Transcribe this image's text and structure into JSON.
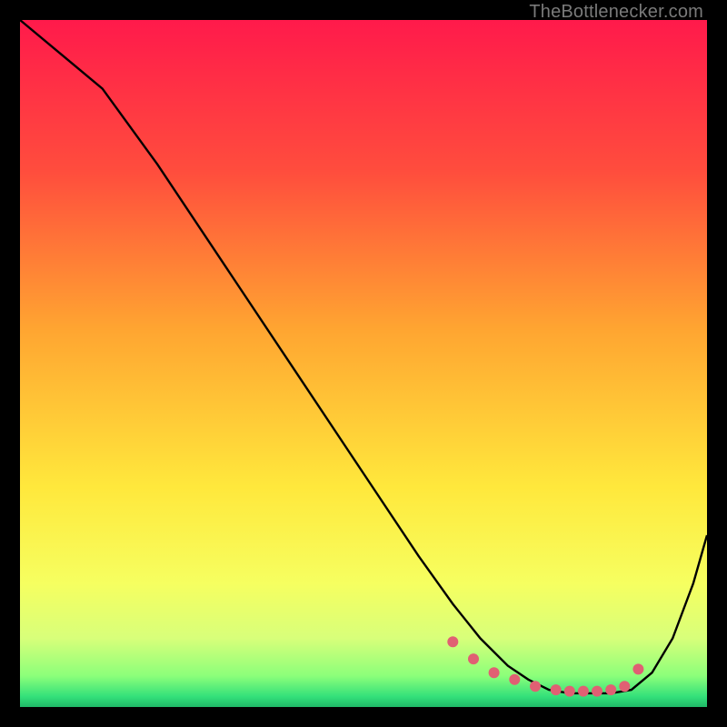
{
  "attribution": "TheBottlenecker.com",
  "chart_data": {
    "type": "line",
    "title": "",
    "xlabel": "",
    "ylabel": "",
    "xlim": [
      0,
      100
    ],
    "ylim": [
      0,
      100
    ],
    "grid": false,
    "legend": false,
    "background_gradient": {
      "stops": [
        {
          "offset": 0,
          "color": "#ff1a4b"
        },
        {
          "offset": 0.22,
          "color": "#ff4d3d"
        },
        {
          "offset": 0.45,
          "color": "#ffa531"
        },
        {
          "offset": 0.68,
          "color": "#ffe83c"
        },
        {
          "offset": 0.82,
          "color": "#f6ff60"
        },
        {
          "offset": 0.9,
          "color": "#d8ff7a"
        },
        {
          "offset": 0.955,
          "color": "#8bff7a"
        },
        {
          "offset": 0.985,
          "color": "#33e07a"
        },
        {
          "offset": 1.0,
          "color": "#1fb867"
        }
      ]
    },
    "series": [
      {
        "name": "curve",
        "color": "#000000",
        "x": [
          0,
          6,
          12,
          20,
          30,
          40,
          50,
          58,
          63,
          67,
          71,
          74,
          77,
          80,
          83,
          86,
          89,
          92,
          95,
          98,
          100
        ],
        "y": [
          100,
          95,
          90,
          79,
          64,
          49,
          34,
          22,
          15,
          10,
          6,
          4,
          2.5,
          2,
          2,
          2,
          2.5,
          5,
          10,
          18,
          25
        ]
      }
    ],
    "markers": {
      "name": "highlight-points",
      "color": "#e06073",
      "radius": 6,
      "x": [
        63,
        66,
        69,
        72,
        75,
        78,
        80,
        82,
        84,
        86,
        88,
        90
      ],
      "y": [
        9.5,
        7,
        5,
        4,
        3,
        2.5,
        2.3,
        2.3,
        2.3,
        2.5,
        3,
        5.5
      ]
    }
  }
}
